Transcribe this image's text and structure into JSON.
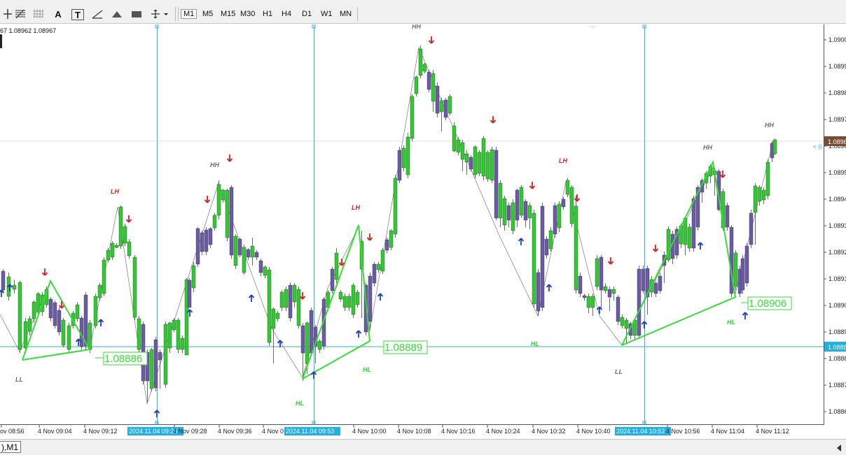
{
  "toolbar": {
    "timeframes": [
      "M1",
      "M5",
      "M15",
      "M30",
      "H1",
      "H4",
      "D1",
      "W1",
      "MN"
    ],
    "active_timeframe": "M1",
    "tools": [
      {
        "name": "crosshair-icon"
      },
      {
        "name": "fibonacci-icon"
      },
      {
        "name": "grid-icon"
      },
      {
        "name": "text-tool-icon",
        "glyph": "A"
      },
      {
        "name": "text-label-icon",
        "glyph": "T"
      },
      {
        "name": "trendline-icon"
      },
      {
        "name": "triangle-icon"
      },
      {
        "name": "rectangle-icon"
      },
      {
        "name": "arrows-menu-icon"
      }
    ]
  },
  "chart": {
    "ohlc_text": "67 1.08962 1.08967",
    "current_price": "1.0896",
    "current_price_marker": "< 0",
    "grid_price": "1.0888",
    "price_axis": [
      "1.0900",
      "1.0899",
      "1.0898",
      "1.0897",
      "1.0896",
      "1.0895",
      "1.0894",
      "1.0893",
      "1.0892",
      "1.0891",
      "1.0890",
      "1.0889",
      "1.0888",
      "1.0887",
      "1.0886"
    ],
    "time_labels": [
      "ov 08:56",
      "4 Nov 09:04",
      "4 Nov 09:12",
      "4 Nov 09:28",
      "4 Nov 09:36",
      "4 Nov 0",
      "4 Nov 10:00",
      "4 Nov 10:08",
      "4 Nov 10:16",
      "4 Nov 10:24",
      "4 Nov 10:32",
      "4 Nov 10:40",
      "4 Nov 10:56",
      "4 Nov 11:04",
      "4 Nov 11:12"
    ],
    "vline_dates": [
      "2024.11.04 09:25",
      "2024.11.04 09:53",
      "2024.11.04 10:52"
    ],
    "value_boxes": [
      "1.08886",
      "1.08889",
      "1.08906"
    ],
    "swing_labels": [
      {
        "text": "LL",
        "kind": "gray"
      },
      {
        "text": "LH",
        "kind": "red"
      },
      {
        "text": "HH",
        "kind": "gray"
      },
      {
        "text": "LH",
        "kind": "red"
      },
      {
        "text": "HH",
        "kind": "gray"
      },
      {
        "text": "HL",
        "kind": "green"
      },
      {
        "text": "HL",
        "kind": "green"
      },
      {
        "text": "HL",
        "kind": "green"
      },
      {
        "text": "LH",
        "kind": "red"
      },
      {
        "text": "LL",
        "kind": "gray"
      },
      {
        "text": "HH",
        "kind": "gray"
      },
      {
        "text": "HL",
        "kind": "green"
      },
      {
        "text": "HH",
        "kind": "gray"
      }
    ],
    "colors": {
      "bull": "#2ecc2e",
      "bear": "#6b5aa8",
      "zigzag": "#33dd33",
      "vline": "#35aadd",
      "price_tag": "#7b4a33",
      "date_tag": "#1eb0e6",
      "arrow_up": "#1c3fbf",
      "arrow_down": "#d42020"
    }
  },
  "bottom": {
    "symbol_tab": "),M1"
  }
}
